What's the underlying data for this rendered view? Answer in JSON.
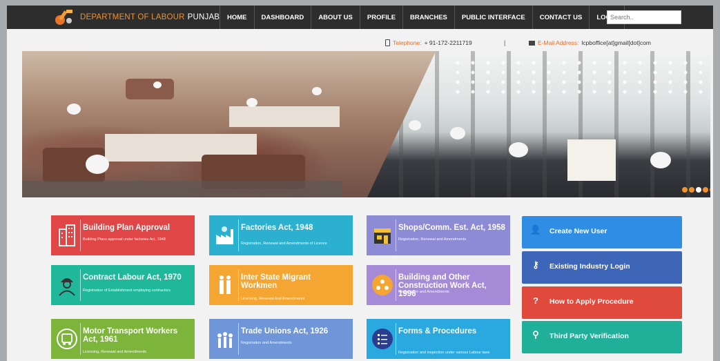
{
  "brand": {
    "title_part1": "DEPARTMENT OF LABOUR",
    "title_part2": "PUNJAB"
  },
  "nav": {
    "items": [
      "HOME",
      "DASHBOARD",
      "ABOUT US",
      "PROFILE",
      "BRANCHES",
      "PUBLIC INTERFACE",
      "CONTACT US",
      "LOGIN"
    ]
  },
  "search": {
    "placeholder": "Search.."
  },
  "contact": {
    "phone_label": "Telephone:",
    "phone_value": "+ 91-172-2211719",
    "separator": "|",
    "email_label": "E-Mail Address:",
    "email_value": "lcpboffice[at]gmail[dot]com"
  },
  "slider": {
    "dots": 5
  },
  "tiles": [
    {
      "title": "Building Plan Approval",
      "subtitle": "Building Plans approval under factories Act, 1948",
      "color": "#e04646",
      "icon": "building-icon"
    },
    {
      "title": "Factories Act, 1948",
      "subtitle": "Registration, Renewal and Amendments of Licence",
      "color": "#2cb0d0",
      "icon": "factory-icon"
    },
    {
      "title": "Shops/Comm. Est. Act, 1958",
      "subtitle": "Registration, Renewal and Amendments",
      "color": "#8e8bd6",
      "icon": "shop-icon"
    },
    {
      "title": "Contract Labour Act, 1970",
      "subtitle": "Registration of Establishment employing contractors",
      "color": "#1fb89a",
      "icon": "worker-icon"
    },
    {
      "title": "Inter State Migrant Workmen",
      "subtitle": "Licensing, Renewal And Amendments",
      "color": "#f5a632",
      "icon": "migrant-icon"
    },
    {
      "title": "Building and Other Construction Work Act, 1996",
      "subtitle": "Registration and Amendments",
      "color": "#a58ad8",
      "icon": "construction-icon"
    },
    {
      "title": "Motor Transport Workers Act, 1961",
      "subtitle": "Licensing, Renewal and Amendments",
      "color": "#7cb53a",
      "icon": "bus-icon"
    },
    {
      "title": "Trade Unions Act, 1926",
      "subtitle": "Registration and Amendments",
      "color": "#6e96d8",
      "icon": "union-icon"
    },
    {
      "title": "Forms & Procedures",
      "subtitle": "Registration and inspection under various Labour laws",
      "color": "#2aa8e0",
      "icon": "forms-icon"
    }
  ],
  "side_buttons": [
    {
      "label": "Create New User",
      "color": "#2f8ee3",
      "icon": "user-icon",
      "glyph": "👤"
    },
    {
      "label": "Existing Industry Login",
      "color": "#3d65b8",
      "icon": "key-icon",
      "glyph": "⚷"
    },
    {
      "label": "How to Apply Procedure",
      "color": "#e04a3c",
      "icon": "question-icon",
      "glyph": "?"
    },
    {
      "label": "Third Party Verification",
      "color": "#20b09a",
      "icon": "search-icon",
      "glyph": "⚲"
    }
  ]
}
